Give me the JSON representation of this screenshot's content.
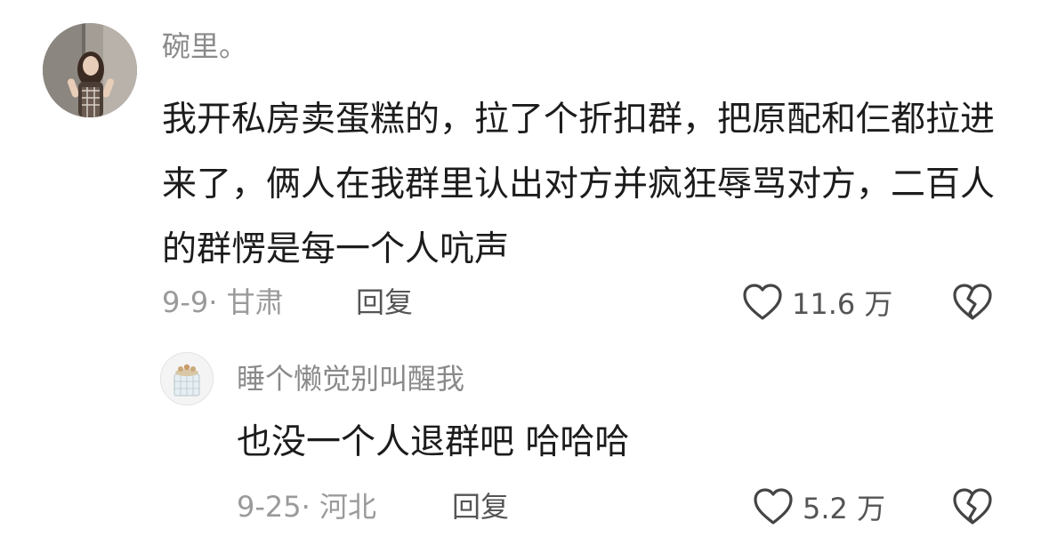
{
  "main_comment": {
    "username": "碗里。",
    "text": "我开私房卖蛋糕的，拉了个折扣群，把原配和仨都拉进来了，俩人在我群里认出对方并疯狂辱骂对方，二百人的群愣是每一个人吭声",
    "date_location": "9-9· 甘肃",
    "reply_label": "回复",
    "like_count": "11.6 万",
    "like_icon": "heart-outline-icon",
    "dislike_icon": "broken-heart-icon"
  },
  "reply_comment": {
    "username": "睡个懒觉别叫醒我",
    "text": "也没一个人退群吧 哈哈哈",
    "date_location": "9-25· 河北",
    "reply_label": "回复",
    "like_count": "5.2 万",
    "like_icon": "heart-outline-icon",
    "dislike_icon": "broken-heart-icon"
  },
  "colors": {
    "username": "#8a8a8a",
    "body_text": "#1c1c1c",
    "meta_text": "#9a9a9a",
    "action_text": "#555555",
    "icon_stroke": "#444444"
  }
}
